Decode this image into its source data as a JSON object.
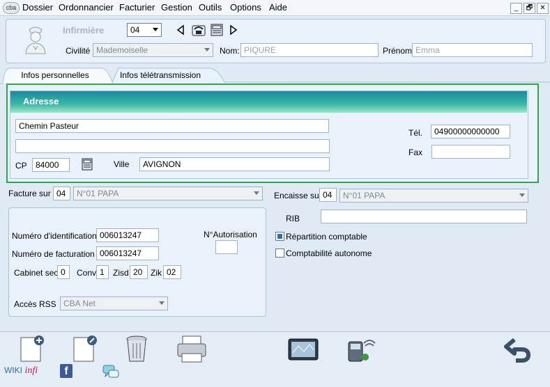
{
  "menu": {
    "logo": "cba",
    "items": [
      "Dossier",
      "Ordonnancier",
      "Facturier",
      "Gestion",
      "Outils",
      "Options",
      "Aide"
    ]
  },
  "window_controls": {
    "minimize": "_",
    "restore": "🗗",
    "close": "✕"
  },
  "header": {
    "title": "Infirmière",
    "nurse_number": "04",
    "civilite_label": "Civilité",
    "civilite_value": "Mademoiselle",
    "nom_label": "Nom:",
    "nom_value": "PIQURE",
    "prenom_label": "Prénom",
    "prenom_value": "Emma"
  },
  "tabs": [
    {
      "label": "Infos personnelles",
      "active": true
    },
    {
      "label": "Infos télétransmission",
      "active": false
    }
  ],
  "adresse": {
    "title": "Adresse",
    "line1": "Chemin Pasteur",
    "line2": "",
    "cp_label": "CP",
    "cp_value": "84000",
    "ville_label": "Ville",
    "ville_value": "AVIGNON",
    "tel_label": "Tél.",
    "tel_value": "04900000000000",
    "fax_label": "Fax",
    "fax_value": ""
  },
  "facture": {
    "label": "Facture sur",
    "number": "04",
    "name": "N°01 PAPA"
  },
  "encaisse": {
    "label": "Encaisse sur",
    "number": "04",
    "name": "N°01 PAPA"
  },
  "ident": {
    "num_ident_label": "Numéro d'identification",
    "num_ident_value": "006013247",
    "num_fact_label": "Numéro de facturation",
    "num_fact_value": "006013247",
    "autorisation_label": "N°Autorisation",
    "autorisation_value": "",
    "cabinet_label": "Cabinet sec.",
    "cabinet_value": "0",
    "conv_label": "Conv",
    "conv_value": "1",
    "zisd_label": "Zisd",
    "zisd_value": "20",
    "zik_label": "Zik",
    "zik_value": "02",
    "acces_label": "Accès RSS",
    "acces_value": "CBA Net"
  },
  "rib": {
    "label": "RIB",
    "value": ""
  },
  "options": {
    "repartition_label": "Répartition comptable",
    "repartition_checked": true,
    "comptabilite_label": "Comptabilité autonome",
    "comptabilite_checked": false
  },
  "footer": {
    "wiki": "WIKI",
    "infi": "infi",
    "facebook_glyph": "f"
  },
  "colors": {
    "accent_green": "#2aa84a",
    "header_gradient_top": "#1a8a9c",
    "header_gradient_bottom": "#9ee6c8"
  }
}
